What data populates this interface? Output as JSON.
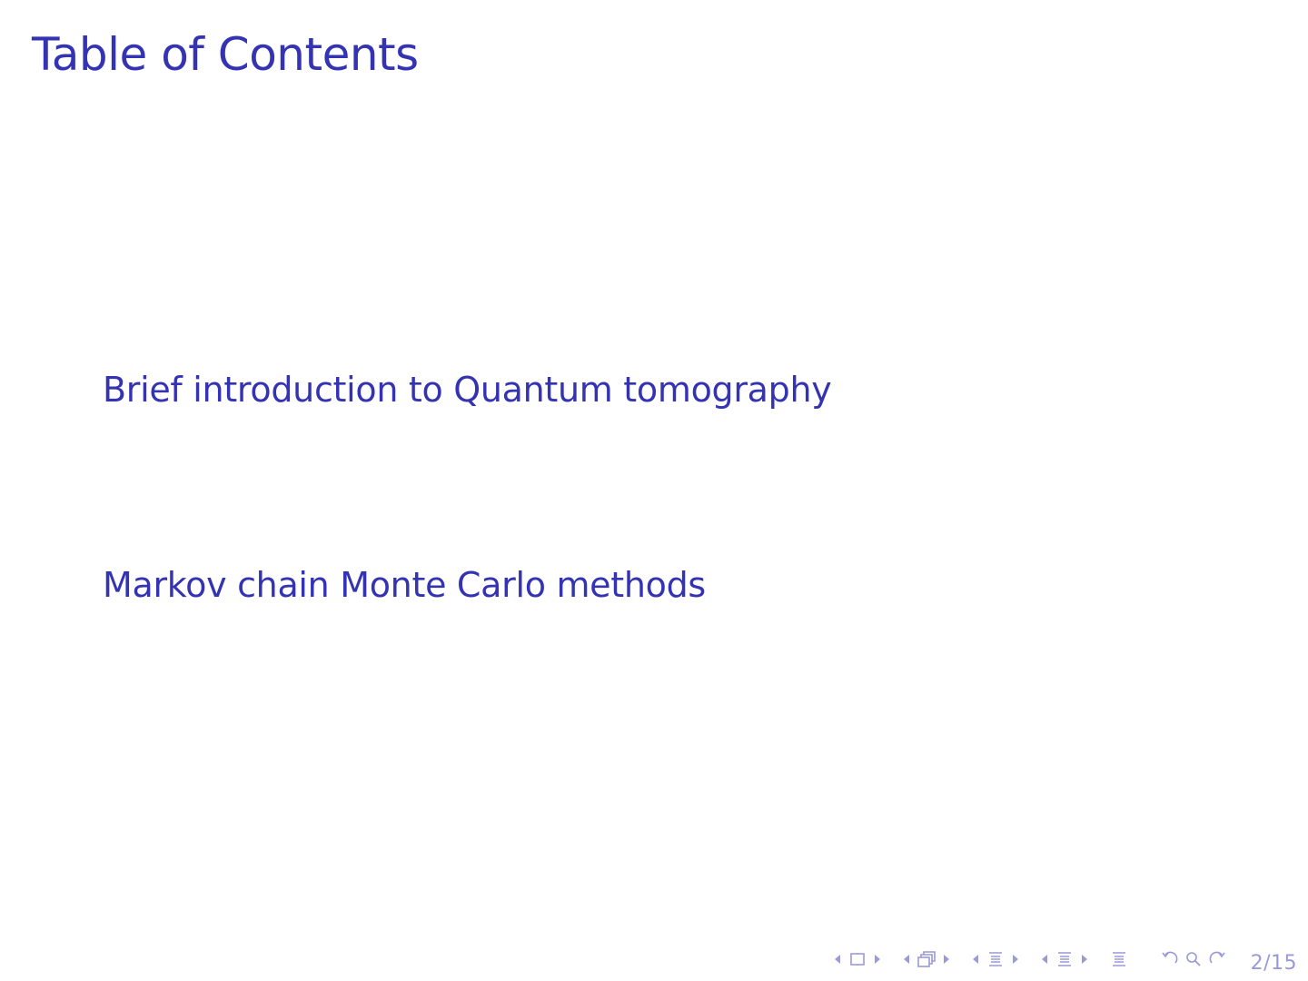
{
  "slide": {
    "title": "Table of Contents",
    "toc_items": [
      "Brief introduction to Quantum tomography",
      "Markov chain Monte Carlo methods"
    ],
    "page_number": "2/15"
  },
  "colors": {
    "text": "#3333b3",
    "nav_symbols": "#9a9ad6",
    "background": "#ffffff"
  },
  "navigation_icons": [
    "prev-arrow-icon",
    "frame-icon",
    "next-arrow-icon",
    "prev-arrow-icon",
    "subsection-icon",
    "next-arrow-icon",
    "prev-arrow-icon",
    "section-icon",
    "next-arrow-icon",
    "prev-arrow-icon",
    "section-list-icon",
    "next-arrow-icon",
    "outline-icon",
    "back-icon",
    "search-icon",
    "forward-icon"
  ]
}
